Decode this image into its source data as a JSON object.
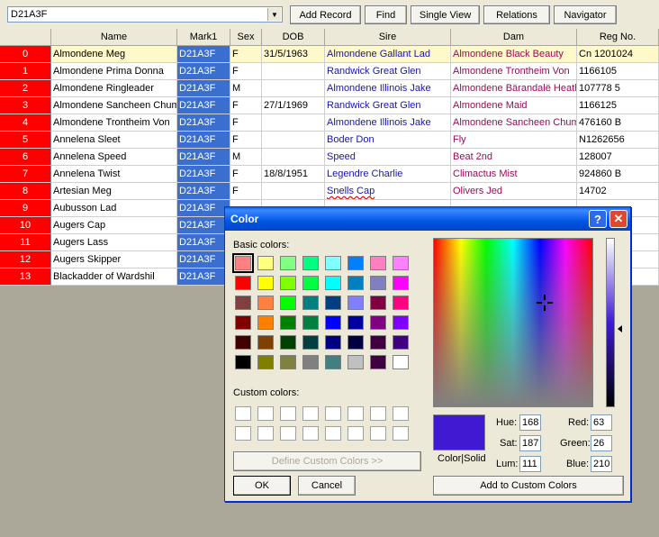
{
  "toolbar": {
    "combo_value": "D21A3F",
    "buttons": [
      "Add Record",
      "Find",
      "Single View",
      "Relations",
      "Navigator"
    ]
  },
  "table": {
    "headers": [
      "",
      "Name",
      "Mark1",
      "Sex",
      "DOB",
      "Sire",
      "Dam",
      "Reg No."
    ],
    "rows": [
      [
        "0",
        "Almondene Meg",
        "D21A3F",
        "F",
        "31/5/1963",
        "Almondene Gallant Lad",
        "Almondene Black Beauty",
        "Cn 1201024"
      ],
      [
        "1",
        "Almondene Prima Donna",
        "D21A3F",
        "F",
        "",
        "Randwick Great Glen",
        "Almondene Trontheim Von",
        "1166105"
      ],
      [
        "2",
        "Almondene Ringleader",
        "D21A3F",
        "M",
        "",
        "Almondene Illinois Jake",
        "Almondene Bärandalë Heath",
        "107778 5"
      ],
      [
        "3",
        "Almondene Sancheen Chum",
        "D21A3F",
        "F",
        "27/1/1969",
        "Randwick Great Glen",
        "Almondene Maid",
        "1166125"
      ],
      [
        "4",
        "Almondene Trontheim Von",
        "D21A3F",
        "F",
        "",
        "Almondene Illinois Jake",
        "Almondene Sancheen Chum",
        "476160 B"
      ],
      [
        "5",
        "Annelena Sleet",
        "D21A3F",
        "F",
        "",
        "Boder Don",
        "Fly",
        "N1262656"
      ],
      [
        "6",
        "Annelena Speed",
        "D21A3F",
        "M",
        "",
        "Speed",
        "Beat 2nd",
        "128007"
      ],
      [
        "7",
        "Annelena Twist",
        "D21A3F",
        "F",
        "18/8/1951",
        "Legendre Charlie",
        "Climactus Mist",
        "924860 B"
      ],
      [
        "8",
        "Artesian Meg",
        "D21A3F",
        "F",
        "",
        "Snells Cap",
        "Olivers Jed",
        "14702"
      ],
      [
        "9",
        "Aubusson Lad",
        "D21A3F",
        "",
        "",
        "",
        "",
        ""
      ],
      [
        "10",
        "Augers Cap",
        "D21A3F",
        "",
        "",
        "",
        "",
        ""
      ],
      [
        "11",
        "Augers Lass",
        "D21A3F",
        "",
        "",
        "",
        "",
        ""
      ],
      [
        "12",
        "Augers Skipper",
        "D21A3F",
        "",
        "",
        "",
        "",
        ""
      ],
      [
        "13",
        "Blackadder of Wardshil",
        "D21A3F",
        "",
        "",
        "",
        "",
        ""
      ]
    ]
  },
  "dialog": {
    "title": "Color",
    "basic_colors_label": "Basic colors:",
    "custom_colors_label": "Custom colors:",
    "define_button": "Define Custom Colors >>",
    "ok": "OK",
    "cancel": "Cancel",
    "add_button": "Add to Custom Colors",
    "color_solid": "Color|Solid",
    "hue_label": "Hue:",
    "hue": "168",
    "sat_label": "Sat:",
    "sat": "187",
    "lum_label": "Lum:",
    "lum": "111",
    "red_label": "Red:",
    "red": "63",
    "green_label": "Green:",
    "green": "26",
    "blue_label": "Blue:",
    "blue": "210",
    "current_color": "#3f1ad2",
    "basic_colors": [
      [
        "#ff8080",
        "#ffff80",
        "#80ff80",
        "#00ff80",
        "#80ffff",
        "#0080ff",
        "#ff80c0",
        "#ff80ff"
      ],
      [
        "#ff0000",
        "#ffff00",
        "#80ff00",
        "#00ff40",
        "#00ffff",
        "#0080c0",
        "#8080c0",
        "#ff00ff"
      ],
      [
        "#804040",
        "#ff8040",
        "#00ff00",
        "#008080",
        "#004080",
        "#8080ff",
        "#800040",
        "#ff0080"
      ],
      [
        "#800000",
        "#ff8000",
        "#008000",
        "#008040",
        "#0000ff",
        "#0000a0",
        "#800080",
        "#8000ff"
      ],
      [
        "#400000",
        "#804000",
        "#004000",
        "#004040",
        "#000080",
        "#000040",
        "#400040",
        "#400080"
      ],
      [
        "#000000",
        "#808000",
        "#808040",
        "#808080",
        "#408080",
        "#c0c0c0",
        "#400040",
        "#ffffff"
      ]
    ]
  }
}
